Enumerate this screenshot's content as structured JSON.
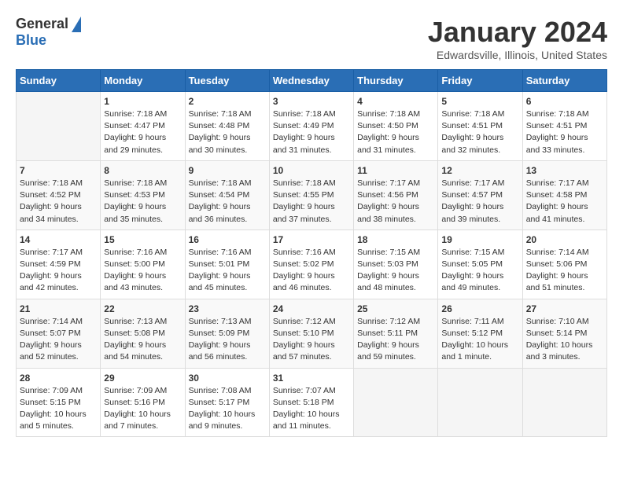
{
  "logo": {
    "general": "General",
    "blue": "Blue"
  },
  "header": {
    "title": "January 2024",
    "subtitle": "Edwardsville, Illinois, United States"
  },
  "weekdays": [
    "Sunday",
    "Monday",
    "Tuesday",
    "Wednesday",
    "Thursday",
    "Friday",
    "Saturday"
  ],
  "weeks": [
    [
      {
        "day": "",
        "info": ""
      },
      {
        "day": "1",
        "info": "Sunrise: 7:18 AM\nSunset: 4:47 PM\nDaylight: 9 hours\nand 29 minutes."
      },
      {
        "day": "2",
        "info": "Sunrise: 7:18 AM\nSunset: 4:48 PM\nDaylight: 9 hours\nand 30 minutes."
      },
      {
        "day": "3",
        "info": "Sunrise: 7:18 AM\nSunset: 4:49 PM\nDaylight: 9 hours\nand 31 minutes."
      },
      {
        "day": "4",
        "info": "Sunrise: 7:18 AM\nSunset: 4:50 PM\nDaylight: 9 hours\nand 31 minutes."
      },
      {
        "day": "5",
        "info": "Sunrise: 7:18 AM\nSunset: 4:51 PM\nDaylight: 9 hours\nand 32 minutes."
      },
      {
        "day": "6",
        "info": "Sunrise: 7:18 AM\nSunset: 4:51 PM\nDaylight: 9 hours\nand 33 minutes."
      }
    ],
    [
      {
        "day": "7",
        "info": "Sunrise: 7:18 AM\nSunset: 4:52 PM\nDaylight: 9 hours\nand 34 minutes."
      },
      {
        "day": "8",
        "info": "Sunrise: 7:18 AM\nSunset: 4:53 PM\nDaylight: 9 hours\nand 35 minutes."
      },
      {
        "day": "9",
        "info": "Sunrise: 7:18 AM\nSunset: 4:54 PM\nDaylight: 9 hours\nand 36 minutes."
      },
      {
        "day": "10",
        "info": "Sunrise: 7:18 AM\nSunset: 4:55 PM\nDaylight: 9 hours\nand 37 minutes."
      },
      {
        "day": "11",
        "info": "Sunrise: 7:17 AM\nSunset: 4:56 PM\nDaylight: 9 hours\nand 38 minutes."
      },
      {
        "day": "12",
        "info": "Sunrise: 7:17 AM\nSunset: 4:57 PM\nDaylight: 9 hours\nand 39 minutes."
      },
      {
        "day": "13",
        "info": "Sunrise: 7:17 AM\nSunset: 4:58 PM\nDaylight: 9 hours\nand 41 minutes."
      }
    ],
    [
      {
        "day": "14",
        "info": "Sunrise: 7:17 AM\nSunset: 4:59 PM\nDaylight: 9 hours\nand 42 minutes."
      },
      {
        "day": "15",
        "info": "Sunrise: 7:16 AM\nSunset: 5:00 PM\nDaylight: 9 hours\nand 43 minutes."
      },
      {
        "day": "16",
        "info": "Sunrise: 7:16 AM\nSunset: 5:01 PM\nDaylight: 9 hours\nand 45 minutes."
      },
      {
        "day": "17",
        "info": "Sunrise: 7:16 AM\nSunset: 5:02 PM\nDaylight: 9 hours\nand 46 minutes."
      },
      {
        "day": "18",
        "info": "Sunrise: 7:15 AM\nSunset: 5:03 PM\nDaylight: 9 hours\nand 48 minutes."
      },
      {
        "day": "19",
        "info": "Sunrise: 7:15 AM\nSunset: 5:05 PM\nDaylight: 9 hours\nand 49 minutes."
      },
      {
        "day": "20",
        "info": "Sunrise: 7:14 AM\nSunset: 5:06 PM\nDaylight: 9 hours\nand 51 minutes."
      }
    ],
    [
      {
        "day": "21",
        "info": "Sunrise: 7:14 AM\nSunset: 5:07 PM\nDaylight: 9 hours\nand 52 minutes."
      },
      {
        "day": "22",
        "info": "Sunrise: 7:13 AM\nSunset: 5:08 PM\nDaylight: 9 hours\nand 54 minutes."
      },
      {
        "day": "23",
        "info": "Sunrise: 7:13 AM\nSunset: 5:09 PM\nDaylight: 9 hours\nand 56 minutes."
      },
      {
        "day": "24",
        "info": "Sunrise: 7:12 AM\nSunset: 5:10 PM\nDaylight: 9 hours\nand 57 minutes."
      },
      {
        "day": "25",
        "info": "Sunrise: 7:12 AM\nSunset: 5:11 PM\nDaylight: 9 hours\nand 59 minutes."
      },
      {
        "day": "26",
        "info": "Sunrise: 7:11 AM\nSunset: 5:12 PM\nDaylight: 10 hours\nand 1 minute."
      },
      {
        "day": "27",
        "info": "Sunrise: 7:10 AM\nSunset: 5:14 PM\nDaylight: 10 hours\nand 3 minutes."
      }
    ],
    [
      {
        "day": "28",
        "info": "Sunrise: 7:09 AM\nSunset: 5:15 PM\nDaylight: 10 hours\nand 5 minutes."
      },
      {
        "day": "29",
        "info": "Sunrise: 7:09 AM\nSunset: 5:16 PM\nDaylight: 10 hours\nand 7 minutes."
      },
      {
        "day": "30",
        "info": "Sunrise: 7:08 AM\nSunset: 5:17 PM\nDaylight: 10 hours\nand 9 minutes."
      },
      {
        "day": "31",
        "info": "Sunrise: 7:07 AM\nSunset: 5:18 PM\nDaylight: 10 hours\nand 11 minutes."
      },
      {
        "day": "",
        "info": ""
      },
      {
        "day": "",
        "info": ""
      },
      {
        "day": "",
        "info": ""
      }
    ]
  ]
}
